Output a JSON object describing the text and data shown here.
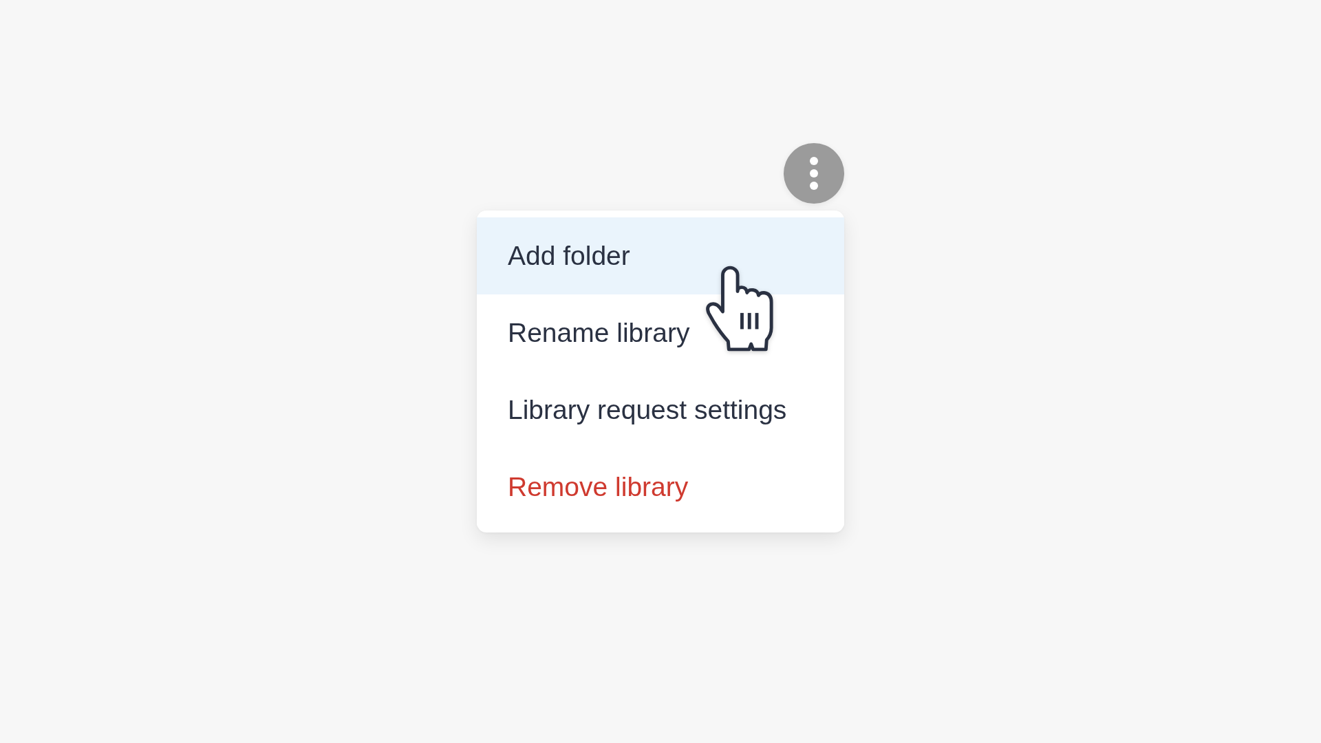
{
  "menu": {
    "items": [
      {
        "label": "Add folder",
        "selected": true,
        "kind": "default"
      },
      {
        "label": "Rename library",
        "selected": false,
        "kind": "default"
      },
      {
        "label": "Library request settings",
        "selected": false,
        "kind": "default"
      },
      {
        "label": "Remove library",
        "selected": false,
        "kind": "destructive"
      }
    ]
  }
}
